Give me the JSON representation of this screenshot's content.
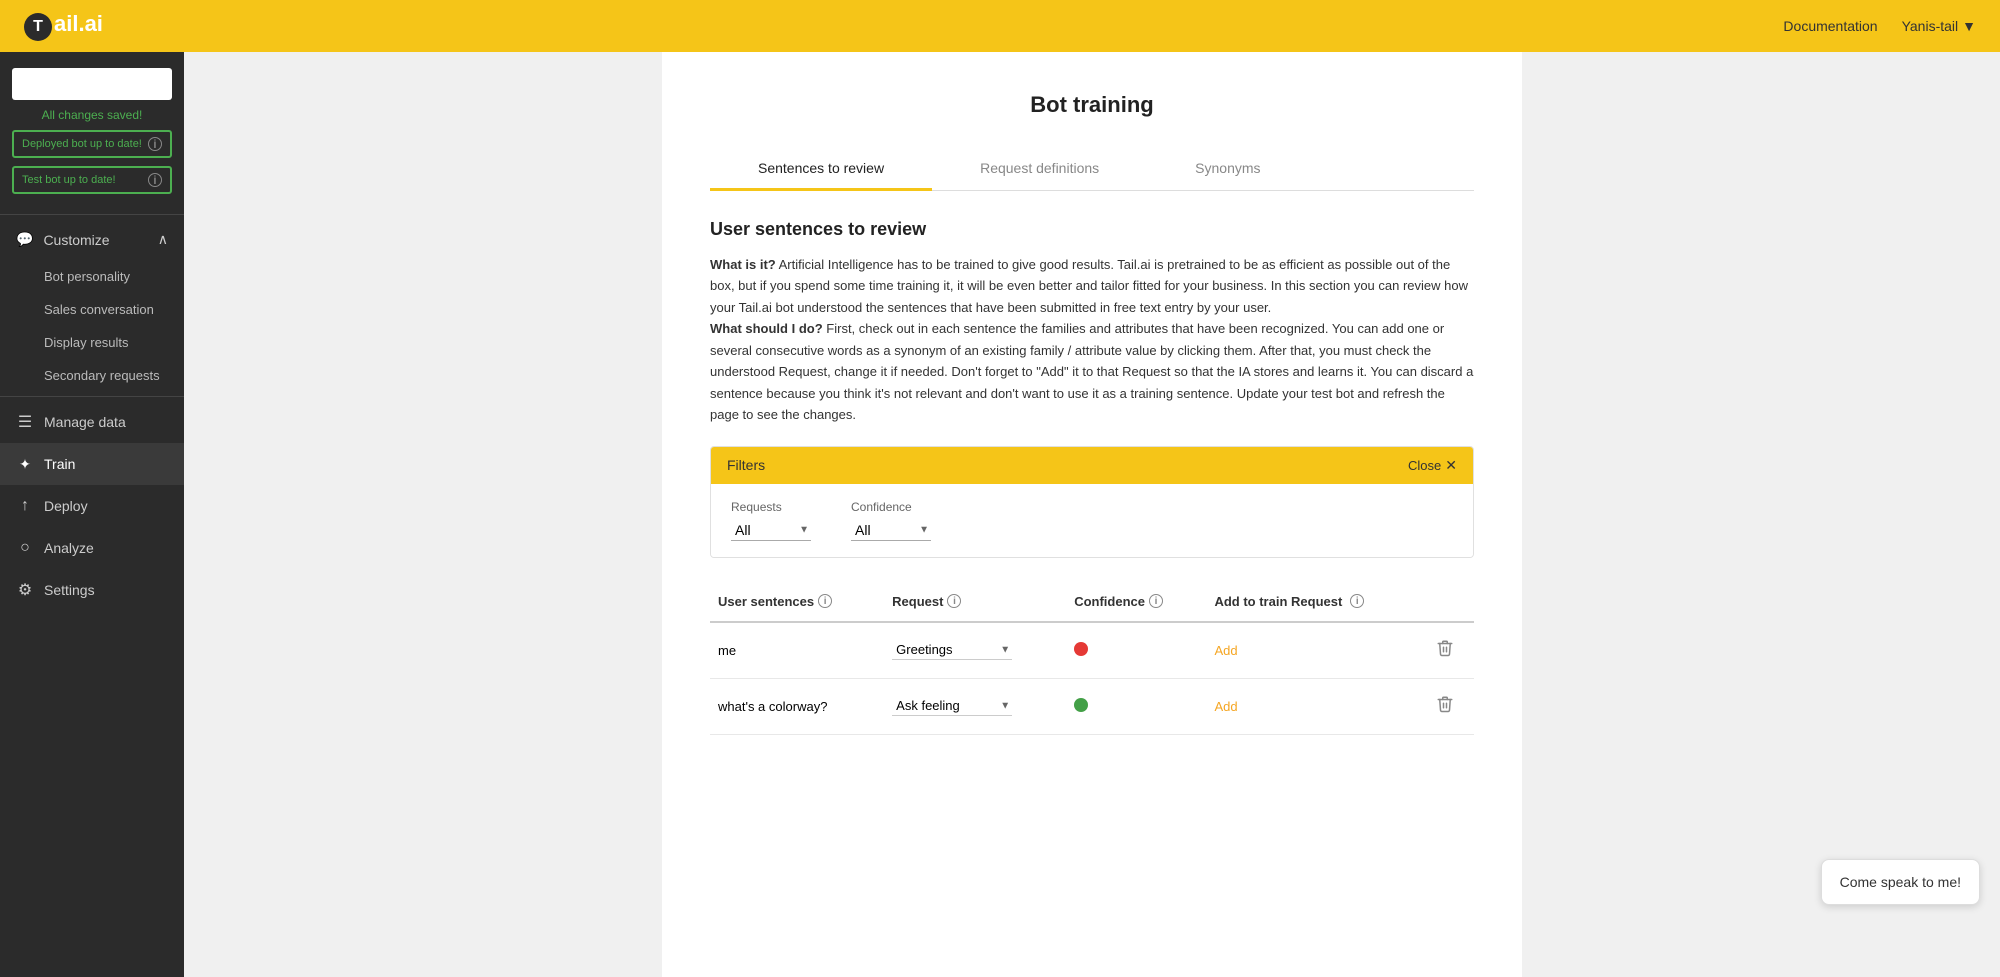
{
  "topbar": {
    "logo": "Tail.ai",
    "logo_t": "T",
    "logo_rest": "ail.ai",
    "doc_link": "Documentation",
    "user": "Yanis-tail",
    "user_chevron": "▼"
  },
  "sidebar": {
    "input_placeholder": "",
    "status": "All changes saved!",
    "btn_deployed": "Deployed bot up to date!",
    "btn_test": "Test bot up to date!",
    "customize_label": "Customize",
    "customize_chevron": "∧",
    "sub_items": [
      {
        "label": "Bot personality"
      },
      {
        "label": "Sales conversation"
      },
      {
        "label": "Display results"
      },
      {
        "label": "Secondary requests"
      }
    ],
    "nav_items": [
      {
        "label": "Manage data",
        "icon": "☰"
      },
      {
        "label": "Train",
        "icon": "✦"
      },
      {
        "label": "Deploy",
        "icon": "↑"
      },
      {
        "label": "Analyze",
        "icon": "○"
      },
      {
        "label": "Settings",
        "icon": "⚙"
      }
    ]
  },
  "main": {
    "title": "Bot training",
    "tabs": [
      {
        "label": "Sentences to review",
        "active": true
      },
      {
        "label": "Request definitions",
        "active": false
      },
      {
        "label": "Synonyms",
        "active": false
      }
    ],
    "section_title": "User sentences to review",
    "info_what_label": "What is it?",
    "info_what_text": "Artificial Intelligence has to be trained to give good results. Tail.ai is pretrained to be as efficient as possible out of the box, but if you spend some time training it, it will be even better and tailor fitted for your business. In this section you can review how your Tail.ai bot understood the sentences that have been submitted in free text entry by your user.",
    "info_should_label": "What should I do?",
    "info_should_text": "First, check out in each sentence the families and attributes that have been recognized. You can add one or several consecutive words as a synonym of an existing family / attribute value by clicking them. After that, you must check the understood Request, change it if needed. Don't forget to \"Add\" it to that Request so that the IA stores and learns it. You can discard a sentence because you think it's not relevant and don't want to use it as a training sentence. Update your test bot and refresh the page to see the changes.",
    "filters": {
      "header": "Filters",
      "close_label": "Close",
      "requests_label": "Requests",
      "requests_value": "All",
      "confidence_label": "Confidence",
      "confidence_value": "All"
    },
    "table": {
      "col_sentences": "User sentences",
      "col_request": "Request",
      "col_confidence": "Confidence",
      "col_add": "Add to train Request",
      "rows": [
        {
          "sentence": "me",
          "request": "Greetings",
          "confidence": "red",
          "add_label": "Add"
        },
        {
          "sentence": "what's a colorway?",
          "request": "Ask feeling",
          "confidence": "green",
          "add_label": "Add"
        }
      ]
    }
  },
  "chat_bubble": {
    "text": "Come speak to me!"
  }
}
